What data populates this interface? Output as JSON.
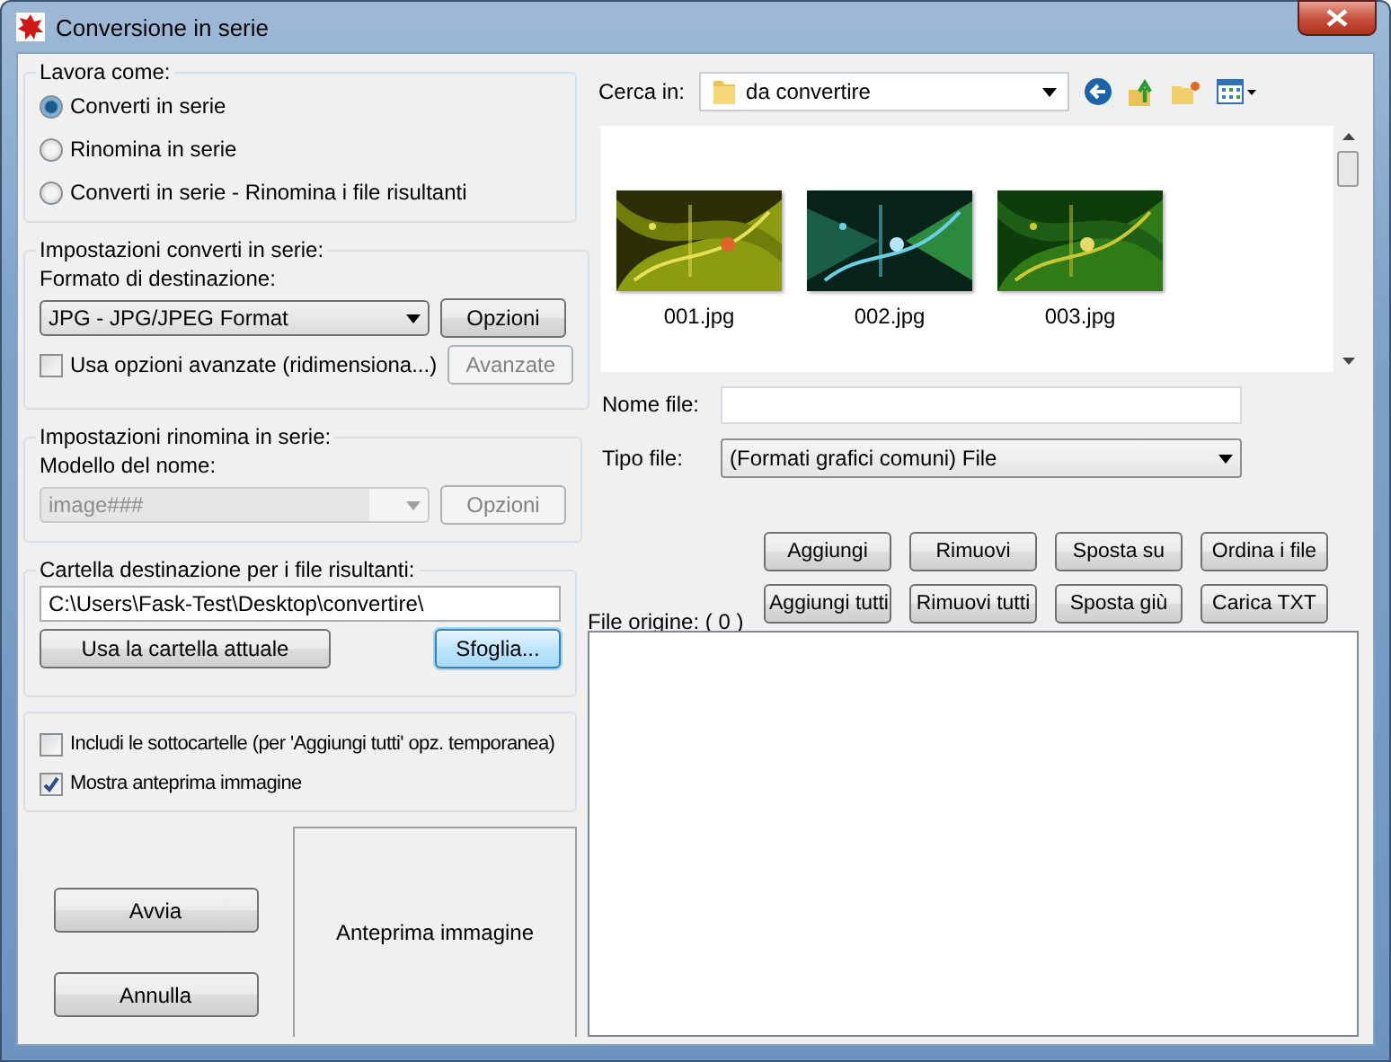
{
  "window": {
    "title": "Conversione in serie"
  },
  "mode_group": {
    "title": "Lavora come:",
    "options": [
      {
        "label": "Converti in serie",
        "selected": true
      },
      {
        "label": "Rinomina in serie",
        "selected": false
      },
      {
        "label": "Converti in serie - Rinomina i file risultanti",
        "selected": false
      }
    ]
  },
  "convert_settings": {
    "title": "Impostazioni converti in serie:",
    "format_label": "Formato di destinazione:",
    "format_value": "JPG - JPG/JPEG Format",
    "options_button": {
      "label": "Opzioni",
      "disabled": false
    },
    "advanced_checkbox": {
      "label": "Usa opzioni avanzate (ridimensiona...)",
      "checked": false
    },
    "advanced_button": {
      "label": "Avanzate",
      "disabled": true
    }
  },
  "rename_settings": {
    "title": "Impostazioni rinomina in serie:",
    "pattern_label": "Modello del nome:",
    "pattern_value": "image###",
    "disabled": true,
    "options_button": {
      "label": "Opzioni",
      "disabled": true
    }
  },
  "destination": {
    "title": "Cartella destinazione per i file risultanti:",
    "path": "C:\\Users\\Fask-Test\\Desktop\\convertire\\",
    "use_current_button": {
      "label": "Usa la cartella attuale",
      "focused": false
    },
    "browse_button": {
      "label": "Sfoglia...",
      "focused": true
    }
  },
  "options": [
    {
      "label": "Includi le sottocartelle (per 'Aggiungi tutti' opz. temporanea)",
      "checked": false
    },
    {
      "label": "Mostra anteprima immagine",
      "checked": true
    }
  ],
  "actions": [
    {
      "label": "Avvia"
    },
    {
      "label": "Annulla"
    }
  ],
  "preview": {
    "label": "Anteprima immagine"
  },
  "browser": {
    "look_in_label": "Cerca in:",
    "folder": "da convertire",
    "files": [
      {
        "name": "001.jpg"
      },
      {
        "name": "002.jpg"
      },
      {
        "name": "003.jpg"
      }
    ],
    "file_name_label": "Nome file:",
    "file_type_label": "Tipo file:",
    "file_type_value": "(Formati grafici comuni) File"
  },
  "list_buttons": [
    [
      {
        "label": "Aggiungi"
      },
      {
        "label": "Rimuovi"
      },
      {
        "label": "Sposta su"
      },
      {
        "label": "Ordina i file"
      }
    ],
    [
      {
        "label": "Aggiungi tutti"
      },
      {
        "label": "Rimuovi tutti"
      },
      {
        "label": "Sposta giù"
      },
      {
        "label": "Carica TXT"
      }
    ]
  ],
  "source": {
    "label": "File origine: ( 0 )"
  }
}
